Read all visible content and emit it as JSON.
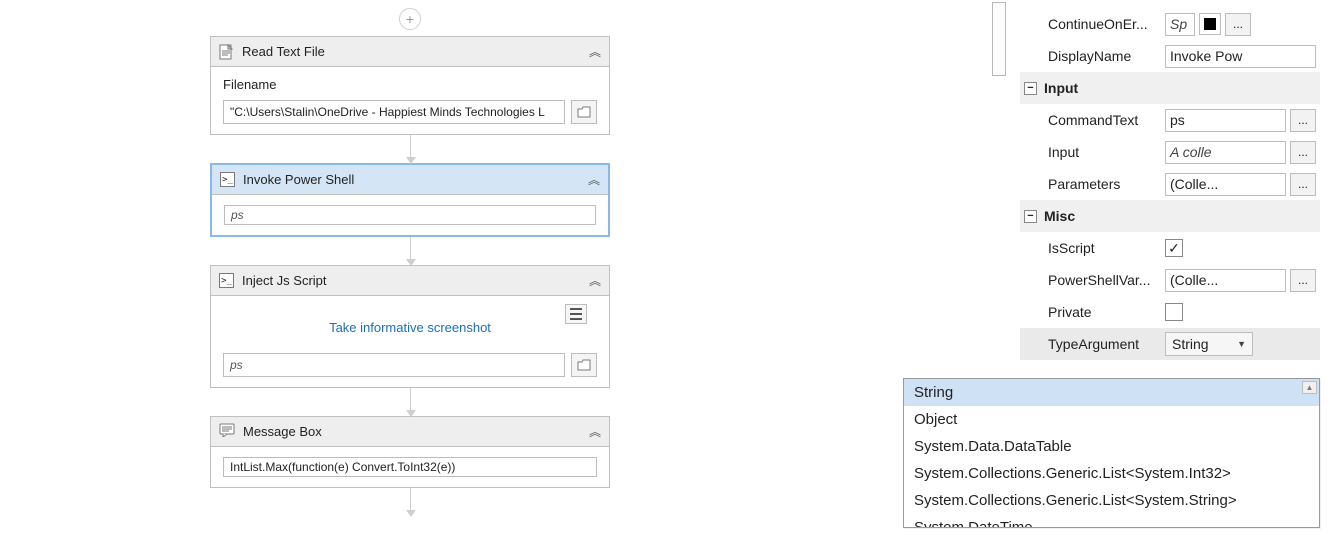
{
  "canvas": {
    "read_text_file": {
      "title": "Read Text File",
      "filename_label": "Filename",
      "filename_value": "\"C:\\Users\\Stalin\\OneDrive - Happiest Minds Technologies L"
    },
    "invoke_ps": {
      "title": "Invoke Power Shell",
      "input_value": "ps"
    },
    "inject_js": {
      "title": "Inject Js Script",
      "link_text": "Take informative screenshot",
      "input_value": "ps"
    },
    "msgbox": {
      "title": "Message Box",
      "input_value": "IntList.Max(function(e) Convert.ToInt32(e))"
    }
  },
  "properties": {
    "continue_on_error": {
      "label": "ContinueOnEr...",
      "value_placeholder": "Sp"
    },
    "display_name": {
      "label": "DisplayName",
      "value": "Invoke Pow"
    },
    "input_section": "Input",
    "command_text": {
      "label": "CommandText",
      "value": "ps"
    },
    "input_field": {
      "label": "Input",
      "placeholder": "A colle"
    },
    "parameters": {
      "label": "Parameters",
      "value": "(Colle..."
    },
    "misc_section": "Misc",
    "is_script": {
      "label": "IsScript",
      "checked": true
    },
    "powershell_var": {
      "label": "PowerShellVar...",
      "value": "(Colle..."
    },
    "private": {
      "label": "Private",
      "checked": false
    },
    "type_argument": {
      "label": "TypeArgument",
      "selected": "String"
    }
  },
  "dropdown": {
    "tooltip": "String",
    "items": [
      "String",
      "Object",
      "System.Data.DataTable",
      "System.Collections.Generic.List<System.Int32>",
      "System.Collections.Generic.List<System.String>",
      "System.DateTime"
    ]
  }
}
